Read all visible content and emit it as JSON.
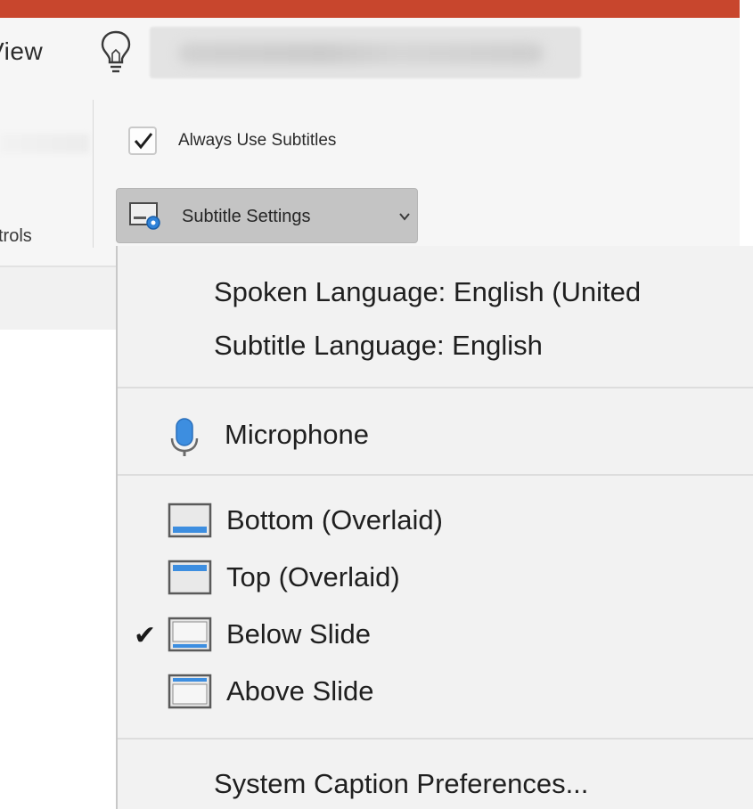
{
  "ribbon": {
    "tab_label": "View",
    "group_label": "trols",
    "always_use_subtitles": {
      "label": "Always Use Subtitles",
      "checked": true
    },
    "subtitle_settings_button": {
      "label": "Subtitle Settings"
    }
  },
  "menu": {
    "spoken_language": "Spoken Language: English (United",
    "subtitle_language": "Subtitle Language: English",
    "microphone": "Microphone",
    "positions": [
      {
        "label": "Bottom (Overlaid)",
        "checked": false,
        "icon": "bottom-overlaid-icon"
      },
      {
        "label": "Top (Overlaid)",
        "checked": false,
        "icon": "top-overlaid-icon"
      },
      {
        "label": "Below Slide",
        "checked": true,
        "icon": "below-slide-icon"
      },
      {
        "label": "Above Slide",
        "checked": false,
        "icon": "above-slide-icon"
      }
    ],
    "check_glyph": "✔",
    "system_caption": "System Caption Preferences..."
  },
  "colors": {
    "title_bar": "#c8462d",
    "menu_background": "#f2f2f2",
    "accent_blue": "#2f82d8"
  }
}
